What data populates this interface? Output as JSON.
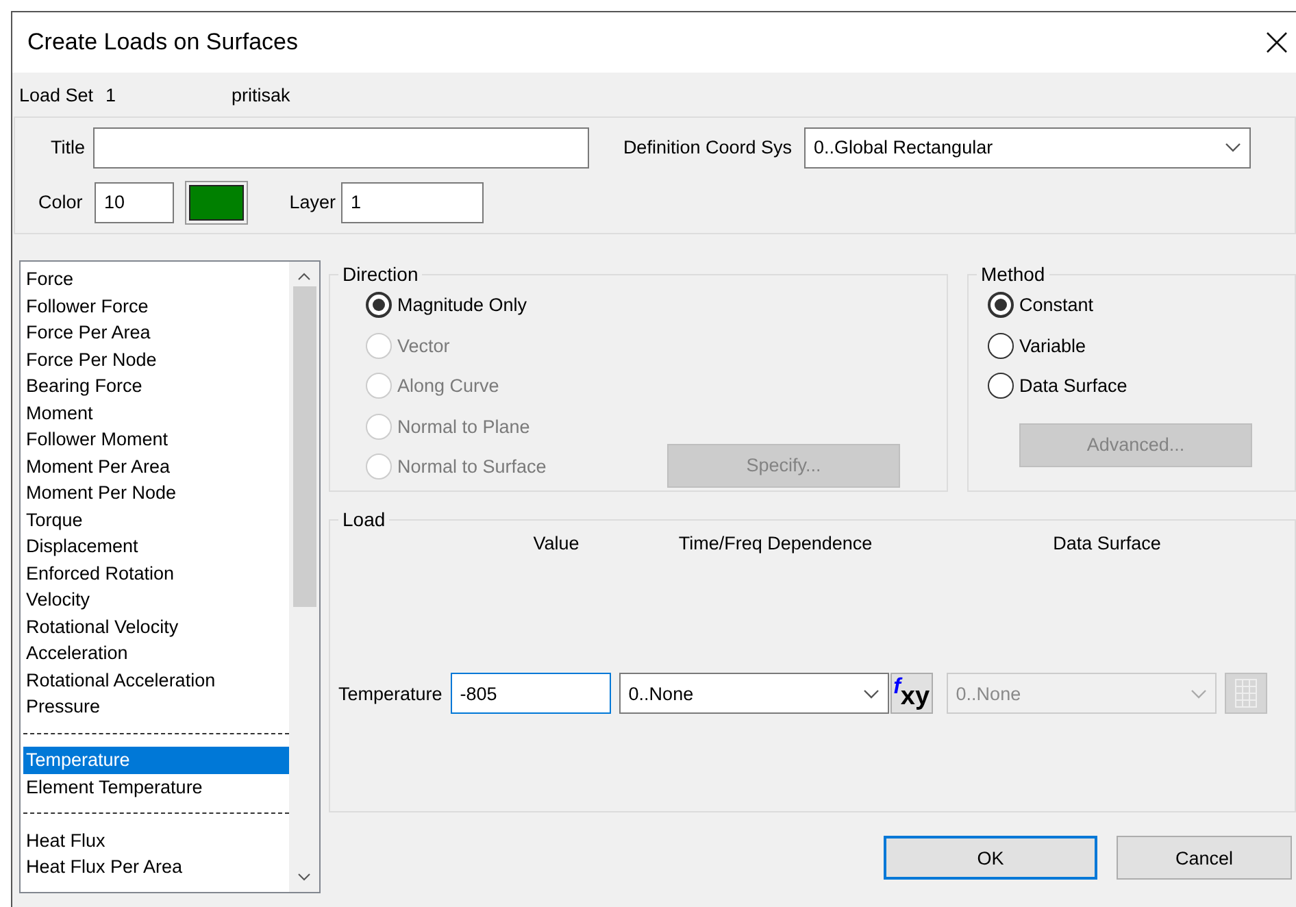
{
  "window": {
    "title": "Create Loads on Surfaces"
  },
  "load_set": {
    "label": "Load Set",
    "number": "1",
    "name": "pritisak"
  },
  "title_field": {
    "label": "Title"
  },
  "coord_sys": {
    "label": "Definition Coord Sys",
    "value": "0..Global Rectangular"
  },
  "color": {
    "label": "Color",
    "value": "10"
  },
  "layer": {
    "label": "Layer",
    "value": "1"
  },
  "load_types": [
    {
      "kind": "item",
      "label": "Force",
      "selected": false
    },
    {
      "kind": "item",
      "label": "Follower Force",
      "selected": false
    },
    {
      "kind": "item",
      "label": "Force Per Area",
      "selected": false
    },
    {
      "kind": "item",
      "label": "Force Per Node",
      "selected": false
    },
    {
      "kind": "item",
      "label": "Bearing Force",
      "selected": false
    },
    {
      "kind": "item",
      "label": "Moment",
      "selected": false
    },
    {
      "kind": "item",
      "label": "Follower Moment",
      "selected": false
    },
    {
      "kind": "item",
      "label": "Moment Per Area",
      "selected": false
    },
    {
      "kind": "item",
      "label": "Moment Per Node",
      "selected": false
    },
    {
      "kind": "item",
      "label": "Torque",
      "selected": false
    },
    {
      "kind": "item",
      "label": "Displacement",
      "selected": false
    },
    {
      "kind": "item",
      "label": "Enforced Rotation",
      "selected": false
    },
    {
      "kind": "item",
      "label": "Velocity",
      "selected": false
    },
    {
      "kind": "item",
      "label": "Rotational Velocity",
      "selected": false
    },
    {
      "kind": "item",
      "label": "Acceleration",
      "selected": false
    },
    {
      "kind": "item",
      "label": "Rotational Acceleration",
      "selected": false
    },
    {
      "kind": "item",
      "label": "Pressure",
      "selected": false
    },
    {
      "kind": "separator"
    },
    {
      "kind": "item",
      "label": "Temperature",
      "selected": true
    },
    {
      "kind": "item",
      "label": "Element Temperature",
      "selected": false
    },
    {
      "kind": "separator"
    },
    {
      "kind": "item",
      "label": "Heat Flux",
      "selected": false
    },
    {
      "kind": "item",
      "label": "Heat Flux Per Area",
      "selected": false
    }
  ],
  "direction": {
    "title": "Direction",
    "options": [
      {
        "label": "Magnitude Only",
        "selected": true,
        "disabled": false
      },
      {
        "label": "Vector",
        "selected": false,
        "disabled": true
      },
      {
        "label": "Along Curve",
        "selected": false,
        "disabled": true
      },
      {
        "label": "Normal to Plane",
        "selected": false,
        "disabled": true
      },
      {
        "label": "Normal to Surface",
        "selected": false,
        "disabled": true
      }
    ],
    "button": {
      "label": "Specify...",
      "disabled": true
    }
  },
  "method": {
    "title": "Method",
    "options": [
      {
        "label": "Constant",
        "selected": true,
        "disabled": false
      },
      {
        "label": "Variable",
        "selected": false,
        "disabled": false
      },
      {
        "label": "Data Surface",
        "selected": false,
        "disabled": false
      }
    ],
    "button": {
      "label": "Advanced...",
      "disabled": true
    }
  },
  "load": {
    "title": "Load",
    "columns": [
      "Value",
      "Time/Freq Dependence",
      "Data Surface"
    ],
    "row": {
      "label": "Temperature",
      "value": "-805",
      "focused": true,
      "dependence": "0..None",
      "data_surface": {
        "value": "0..None",
        "disabled": true
      }
    },
    "function_button": {
      "symbol": "f",
      "subscript": "xy"
    }
  },
  "buttons": [
    {
      "label": "OK",
      "default": true
    },
    {
      "label": "Cancel",
      "default": false
    }
  ]
}
